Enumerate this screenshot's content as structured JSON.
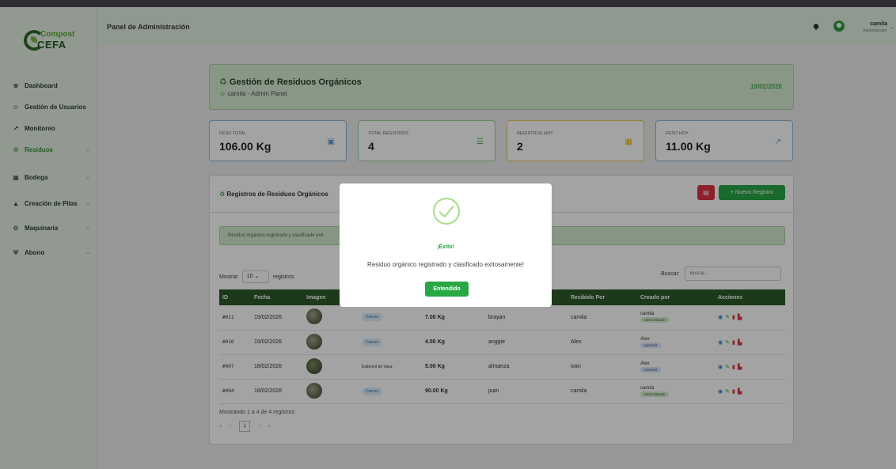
{
  "logo": {
    "line1": "Compost",
    "line2": "CEFA"
  },
  "sidebar": {
    "items": [
      {
        "label": "Dashboard",
        "icon": "dashboard-icon"
      },
      {
        "label": "Gestión de Usuarios",
        "icon": "users-icon"
      },
      {
        "label": "Monitoreo",
        "icon": "chart-line-icon"
      },
      {
        "label": "Residuos",
        "icon": "recycle-icon"
      },
      {
        "label": "Bodega",
        "icon": "warehouse-icon"
      },
      {
        "label": "Creación de Pilas",
        "icon": "pile-icon"
      },
      {
        "label": "Maquinaria",
        "icon": "gears-icon"
      },
      {
        "label": "Abono",
        "icon": "seedling-icon"
      }
    ]
  },
  "topbar": {
    "title": "Panel de Administración",
    "user_name": "camila",
    "user_role": "Administrador"
  },
  "header": {
    "title": "Gestión de Residuos Orgánicos",
    "subtitle": "camila - Admin Panel",
    "date": "19/02/2026"
  },
  "stats": [
    {
      "label": "PESO TOTAL",
      "value": "106.00 Kg",
      "color": "#5b9bd5"
    },
    {
      "label": "TOTAL REGISTROS",
      "value": "4",
      "color": "#4caf50"
    },
    {
      "label": "REGISTROS HOY",
      "value": "2",
      "color": "#f0b400"
    },
    {
      "label": "PESO HOY",
      "value": "11.00 Kg",
      "color": "#5b9bd5"
    }
  ],
  "records": {
    "title": "Registros de Residuos Orgánicos",
    "new_button": "+ Nuevo Registro",
    "alert": "Residuo orgánico registrado y clasificado exit",
    "show_prefix": "Mostrar",
    "show_value": "10",
    "show_suffix": "registros",
    "search_label": "Buscar:",
    "search_placeholder": "Buscar...",
    "columns": [
      "ID",
      "Fecha",
      "Imagen",
      "",
      "",
      "",
      "Recibido Por",
      "Creado por",
      "Acciones"
    ],
    "rows": [
      {
        "id": "#011",
        "fecha": "19/02/2026",
        "tipo": "Carnes",
        "peso": "7.00 Kg",
        "entregado": "brayan",
        "recibido": "camila",
        "creado": "camila",
        "rol": "Administrador"
      },
      {
        "id": "#010",
        "fecha": "19/02/2026",
        "tipo": "Carnes",
        "peso": "4.00 Kg",
        "entregado": "anggie",
        "recibido": "Alex",
        "creado": "Alex",
        "rol": "Aprendiz"
      },
      {
        "id": "#007",
        "fecha": "18/02/2026",
        "tipo": "Estiércol de Vaca",
        "peso": "5.00 Kg",
        "entregado": "almanza",
        "recibido": "ivan",
        "creado": "Alex",
        "rol": "Aprendiz"
      },
      {
        "id": "#004",
        "fecha": "18/02/2026",
        "tipo": "Carnes",
        "peso": "90.00 Kg",
        "entregado": "juan",
        "recibido": "camila",
        "creado": "camila",
        "rol": "Administrador"
      }
    ],
    "info": "Mostrando 1 a 4 de 4 registros",
    "pager": {
      "first": "«",
      "prev": "‹",
      "current": "1",
      "next": "›",
      "last": "»"
    }
  },
  "modal": {
    "title": "¡Éxito!",
    "text": "Residuo orgánico registrado y clasificado exitosamente!",
    "button": "Entendido"
  }
}
